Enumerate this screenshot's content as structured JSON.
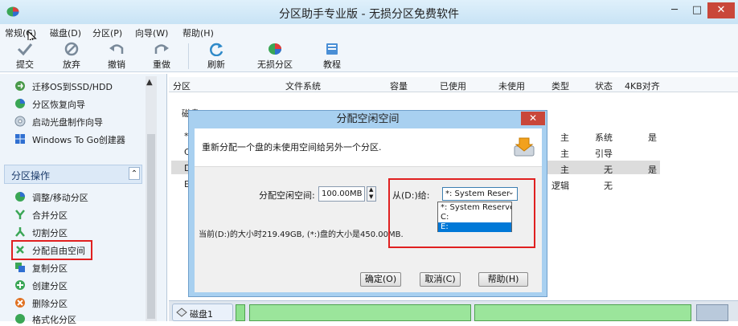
{
  "window": {
    "title": "分区助手专业版 - 无损分区免费软件",
    "controls": [
      "─",
      "□",
      "✕"
    ]
  },
  "menu": [
    "常规(G)",
    "磁盘(D)",
    "分区(P)",
    "向导(W)",
    "帮助(H)"
  ],
  "toolbar": {
    "commit": "提交",
    "discard": "放弃",
    "undo": "撤销",
    "redo": "重做",
    "refresh": "刷新",
    "lossless": "无损分区",
    "tutorial": "教程"
  },
  "sidebar": {
    "wizard_items": [
      "迁移OS到SSD/HDD",
      "分区恢复向导",
      "启动光盘制作向导",
      "Windows To Go创建器"
    ],
    "group_title": "分区操作",
    "group_toggle": "⌃",
    "ops": [
      "调整/移动分区",
      "合并分区",
      "切割分区",
      "分配自由空间",
      "复制分区",
      "创建分区",
      "删除分区",
      "格式化分区"
    ]
  },
  "table": {
    "headers": [
      "分区",
      "文件系统",
      "容量",
      "已使用",
      "未使用",
      "类型",
      "状态",
      "4KB对齐"
    ],
    "disk_label": "磁盘1",
    "rows": [
      {
        "partition": "*",
        "type": "主",
        "status": "系统",
        "align": "是"
      },
      {
        "partition": "C",
        "type": "主",
        "status": "引导",
        "align": ""
      },
      {
        "partition": "D",
        "type": "主",
        "status": "无",
        "align": "是"
      },
      {
        "partition": "E",
        "type": "逻辑",
        "status": "无",
        "align": ""
      }
    ]
  },
  "diskmap": {
    "disk_label": "磁盘1"
  },
  "dialog": {
    "title": "分配空闲空间",
    "close": "✕",
    "description": "重新分配一个盘的未使用空间给另外一个分区.",
    "alloc_label": "分配空闲空间:",
    "alloc_value": "100.00MB",
    "from_label": "从(D:)给:",
    "from_selected": "*: System Reser",
    "options": [
      "*: System Reserved",
      "C:",
      "E:"
    ],
    "info": "当前(D:)的大小时219.49GB, (*:)盘的大小是450.00MB.",
    "ok": "确定(O)",
    "cancel": "取消(C)",
    "help": "帮助(H)"
  }
}
